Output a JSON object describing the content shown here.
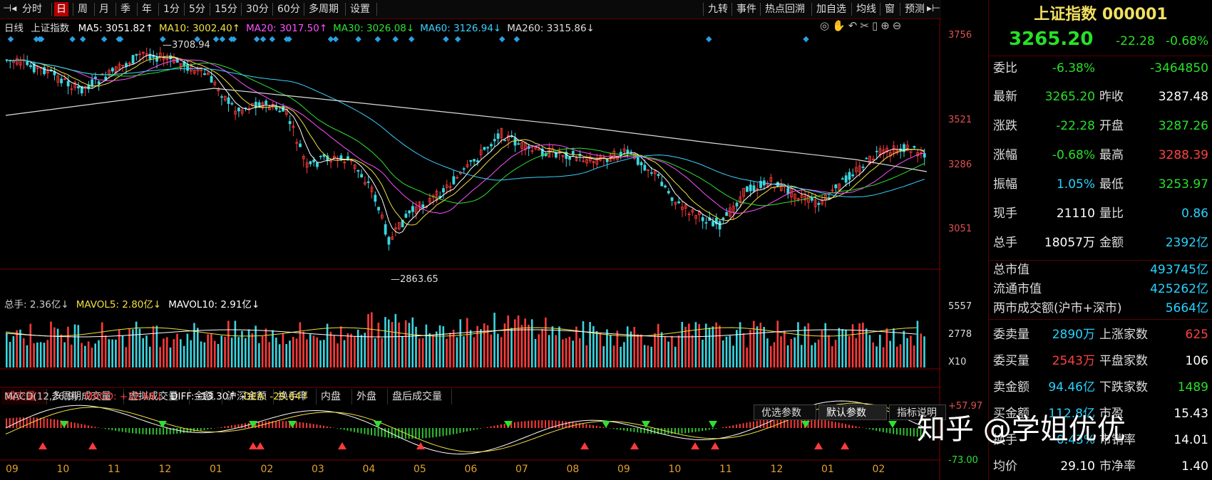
{
  "toolbar": {
    "left": [
      "分时",
      "日",
      "周",
      "月",
      "季",
      "年",
      "1分",
      "5分",
      "15分",
      "30分",
      "60分",
      "多周期",
      "设置"
    ],
    "active": "日",
    "right": [
      "九转",
      "事件",
      "热点回溯",
      "加自选",
      "均线",
      "窗",
      "预测"
    ]
  },
  "legend": {
    "kind": "日线",
    "name": "上证指数",
    "mas": [
      {
        "label": "MA5: 3051.82",
        "arrow": "↑",
        "color": "#ffffff"
      },
      {
        "label": "MA10: 3002.40",
        "arrow": "↑",
        "color": "#f0e040"
      },
      {
        "label": "MA20: 3017.50",
        "arrow": "↑",
        "color": "#ff50ff"
      },
      {
        "label": "MA30: 3026.08",
        "arrow": "↓",
        "color": "#30e030"
      },
      {
        "label": "MA60: 3126.94",
        "arrow": "↓",
        "color": "#3ad0ff"
      },
      {
        "label": "MA260: 3315.86",
        "arrow": "↓",
        "color": "#dddddd"
      }
    ],
    "tools": [
      "eye-icon",
      "hand-icon",
      "undo-icon",
      "scissors-icon",
      "trash-icon",
      "zoom-in-icon",
      "zoom-out-icon"
    ]
  },
  "price_axis": [
    "3756",
    "3521",
    "3286",
    "3051"
  ],
  "annotations": {
    "high": "3708.94",
    "low": "2863.65"
  },
  "volume": {
    "legend": [
      {
        "label": "总手: 2.36亿",
        "arrow": "↓",
        "color": "#cccccc"
      },
      {
        "label": "MAVOL5: 2.80亿",
        "arrow": "↓",
        "color": "#f0e040"
      },
      {
        "label": "MAVOL10: 2.91亿",
        "arrow": "↓",
        "color": "#ffffff"
      }
    ],
    "axis": [
      "5557",
      "2778",
      "X10"
    ]
  },
  "subtabs": [
    "成交量",
    "多周期成交量",
    "虚拟成交量",
    "金额",
    "沪深金额",
    "换手率",
    "内盘",
    "外盘",
    "盘后成交量"
  ],
  "subtab_active": "成交量",
  "macd": {
    "legend": [
      {
        "label": "MACD(12,26,9)",
        "arrow": "",
        "color": "#cccccc"
      },
      {
        "label": "MACD: +32.68",
        "arrow": "↓",
        "color": "#ff4040"
      },
      {
        "label": "DIFF: -13.30",
        "arrow": "↑",
        "color": "#ffffff"
      },
      {
        "label": "DEA: -29.64",
        "arrow": "↑",
        "color": "#f0e040"
      }
    ],
    "params": [
      "优选参数",
      "默认参数",
      "指标说明"
    ],
    "param_active": "默认参数",
    "axis": [
      "+57.97",
      "-73.00"
    ]
  },
  "months": [
    "09",
    "10",
    "11",
    "12",
    "01",
    "02",
    "03",
    "04",
    "05",
    "06",
    "07",
    "08",
    "09",
    "10",
    "11",
    "12",
    "01",
    "02"
  ],
  "quote": {
    "title": "上证指数 000001",
    "price": "3265.20",
    "change": "-22.28",
    "pct": "-0.68%",
    "rows": [
      {
        "k": "委比",
        "v1": "-6.38%",
        "v2": "-3464850",
        "c1": "green",
        "c2": "green"
      },
      {
        "k": "最新",
        "v1": "3265.20",
        "k2": "昨收",
        "v2": "3287.48",
        "c1": "green",
        "c2": "white"
      },
      {
        "k": "涨跌",
        "v1": "-22.28",
        "k2": "开盘",
        "v2": "3287.26",
        "c1": "green",
        "c2": "green"
      },
      {
        "k": "涨幅",
        "v1": "-0.68%",
        "k2": "最高",
        "v2": "3288.39",
        "c1": "green",
        "c2": "red"
      },
      {
        "k": "振幅",
        "v1": "1.05%",
        "k2": "最低",
        "v2": "3253.97",
        "c1": "cyan",
        "c2": "green"
      },
      {
        "k": "现手",
        "v1": "21110",
        "k2": "量比",
        "v2": "0.86",
        "c1": "white",
        "c2": "cyan"
      },
      {
        "k": "总手",
        "v1": "18057万",
        "k2": "金额",
        "v2": "2392亿",
        "c1": "white",
        "c2": "cyan"
      }
    ],
    "mkt": [
      {
        "k": "总市值",
        "v": "493745亿"
      },
      {
        "k": "流通市值",
        "v": "425262亿"
      },
      {
        "k": "两市成交额(沪市+深市)",
        "v": "5664亿"
      }
    ],
    "rows2": [
      {
        "k": "委卖量",
        "v1": "2890万",
        "k2": "上涨家数",
        "v2": "625",
        "c1": "cyan",
        "c2": "red"
      },
      {
        "k": "委买量",
        "v1": "2543万",
        "k2": "平盘家数",
        "v2": "106",
        "c1": "red",
        "c2": "white"
      },
      {
        "k": "卖金额",
        "v1": "94.46亿",
        "k2": "下跌家数",
        "v2": "1489",
        "c1": "cyan",
        "c2": "green"
      },
      {
        "k": "买金额",
        "v1": "112.8亿",
        "k2": "市盈",
        "v2": "15.43",
        "c1": "cyan",
        "c2": "white"
      },
      {
        "k": "换手",
        "v1": "0.43%",
        "k2": "市销率",
        "v2": "14.01",
        "c1": "cyan",
        "c2": "white"
      },
      {
        "k": "均价",
        "v1": "29.10",
        "k2": "市净率",
        "v2": "1.40",
        "c1": "white",
        "c2": "white"
      }
    ]
  },
  "watermark": "知乎 @学姐优优"
}
